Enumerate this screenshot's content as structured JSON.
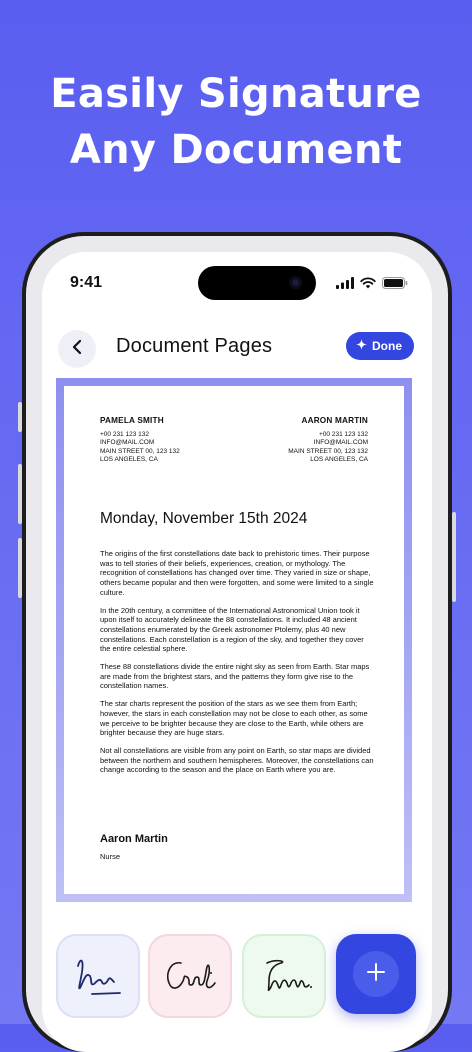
{
  "promo": {
    "headline_line1": "Easily Signature",
    "headline_line2": "Any Document"
  },
  "status_bar": {
    "time": "9:41",
    "icons": [
      "cellular-signal-icon",
      "wifi-icon",
      "battery-icon"
    ]
  },
  "header": {
    "title": "Document Pages",
    "done_label": "Done",
    "back_icon": "chevron-left-icon",
    "done_icon": "sparkle-icon"
  },
  "document": {
    "sender": {
      "name": "PAMELA SMITH",
      "phone": "+00 231 123 132",
      "email": "INFO@MAIL.COM",
      "street": "MAIN STREET 00, 123 132",
      "city": "LOS ANGELES, CA"
    },
    "recipient": {
      "name": "AARON MARTIN",
      "phone": "+00 231 123 132",
      "email": "INFO@MAIL.COM",
      "street": "MAIN STREET 00, 123 132",
      "city": "LOS ANGELES, CA"
    },
    "date": "Monday, November 15th 2024",
    "paragraphs": [
      "The origins of the first constellations date back to prehistoric times. Their purpose was to tell stories of their beliefs, experiences, creation, or mythology. The recognition of constellations has changed over time. They varied in size or shape, others became popular and then were forgotten, and some were limited to a single culture.",
      "In the 20th century, a committee of the International Astronomical Union took it upon itself to accurately delineate the 88 constellations. It included 48 ancient constellations enumerated by the Greek astronomer Ptolemy, plus 40 new constellations. Each constellation is a region of the sky, and together they cover the entire celestial sphere.",
      "These 88 constellations divide the entire night sky as seen from Earth. Star maps are made from the brightest stars, and the patterns they form give rise to the constellation names.",
      "The star charts represent the position of the stars as we see them from Earth; however, the stars in each constellation may not be close to each other, as some we perceive to be brighter because they are close to the Earth, while others are brighter because they are huge stars.",
      "Not all constellations are visible from any point on Earth, so star maps are divided between the northern and southern hemispheres. Moreover, the constellations can change according to the season and the place on Earth where you are."
    ],
    "signer_name": "Aaron Martin",
    "signer_title": "Nurse"
  },
  "signatures": {
    "items": [
      {
        "name": "signature-1",
        "color": "#1f2a6b"
      },
      {
        "name": "signature-2",
        "color": "#1a1a1a"
      },
      {
        "name": "signature-3",
        "color": "#1a1a1a"
      }
    ],
    "add_icon": "plus-icon"
  },
  "colors": {
    "accent": "#3446e0",
    "background": "#6468f2",
    "frame": "#9fa1f2"
  }
}
